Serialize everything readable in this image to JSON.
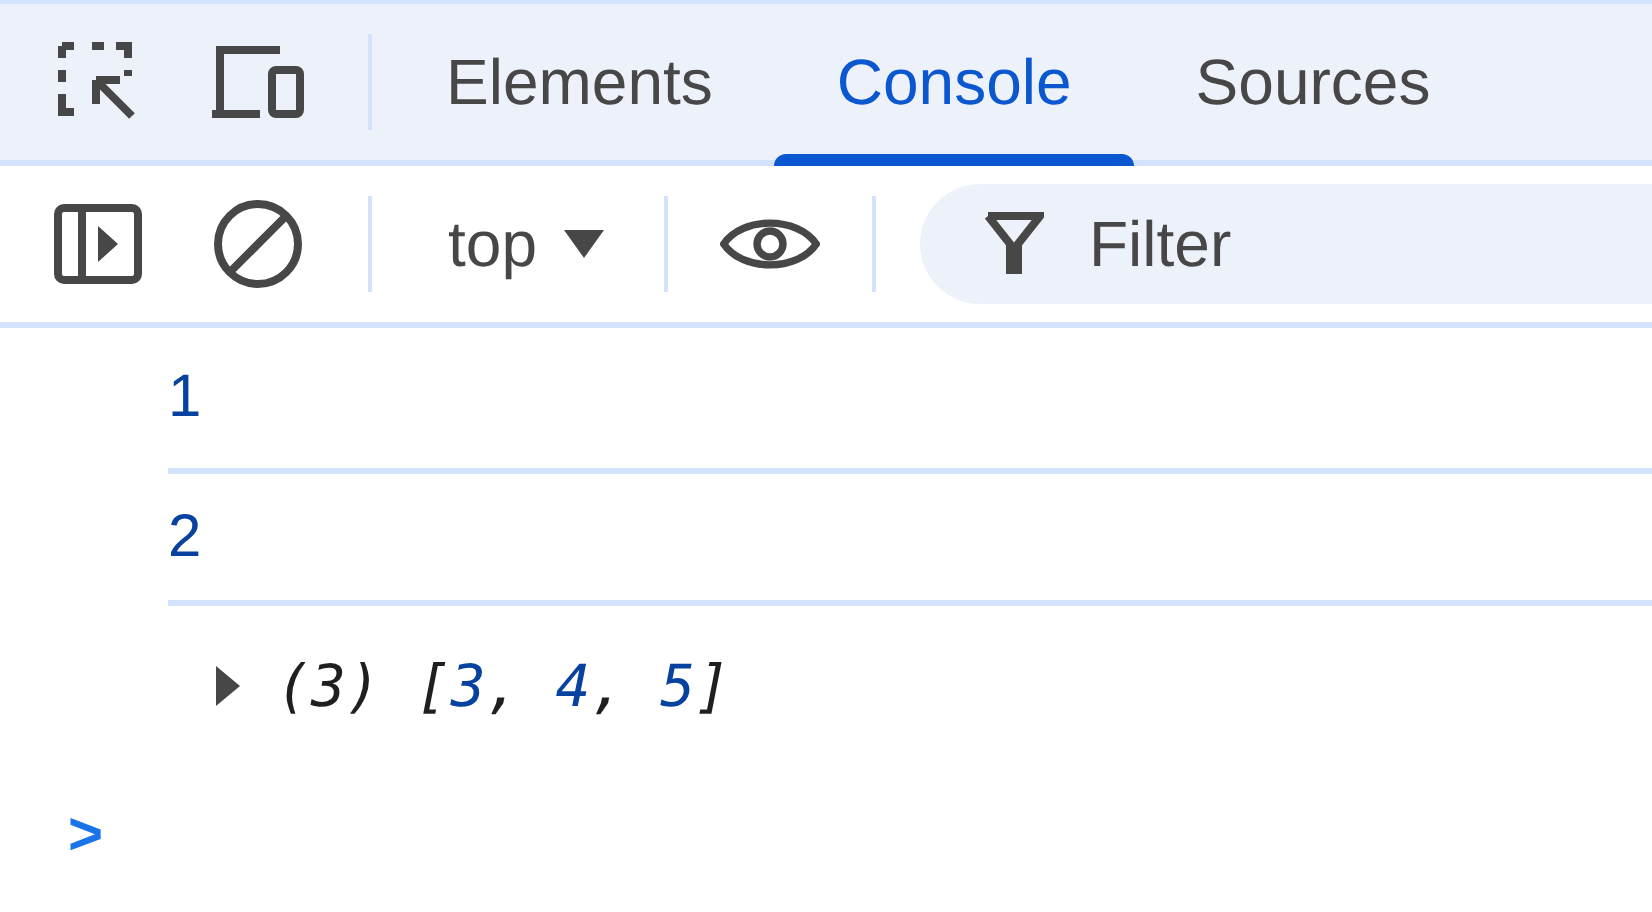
{
  "tabs": [
    {
      "label": "Elements",
      "selected": false
    },
    {
      "label": "Console",
      "selected": true
    },
    {
      "label": "Sources",
      "selected": false
    }
  ],
  "toolbar": {
    "context": "top",
    "filter": {
      "placeholder": "Filter"
    }
  },
  "console": [
    {
      "kind": "value",
      "text": "1"
    },
    {
      "kind": "value",
      "text": "2"
    },
    {
      "kind": "array",
      "expanded": false,
      "tokens": [
        {
          "text": "(3) [",
          "kind": "plain"
        },
        {
          "text": "3",
          "kind": "number"
        },
        {
          "text": ", ",
          "kind": "plain"
        },
        {
          "text": "4",
          "kind": "number"
        },
        {
          "text": ", ",
          "kind": "plain"
        },
        {
          "text": "5",
          "kind": "number"
        },
        {
          "text": "]",
          "kind": "plain"
        }
      ]
    }
  ],
  "prompt": {
    "symbol": ">"
  }
}
